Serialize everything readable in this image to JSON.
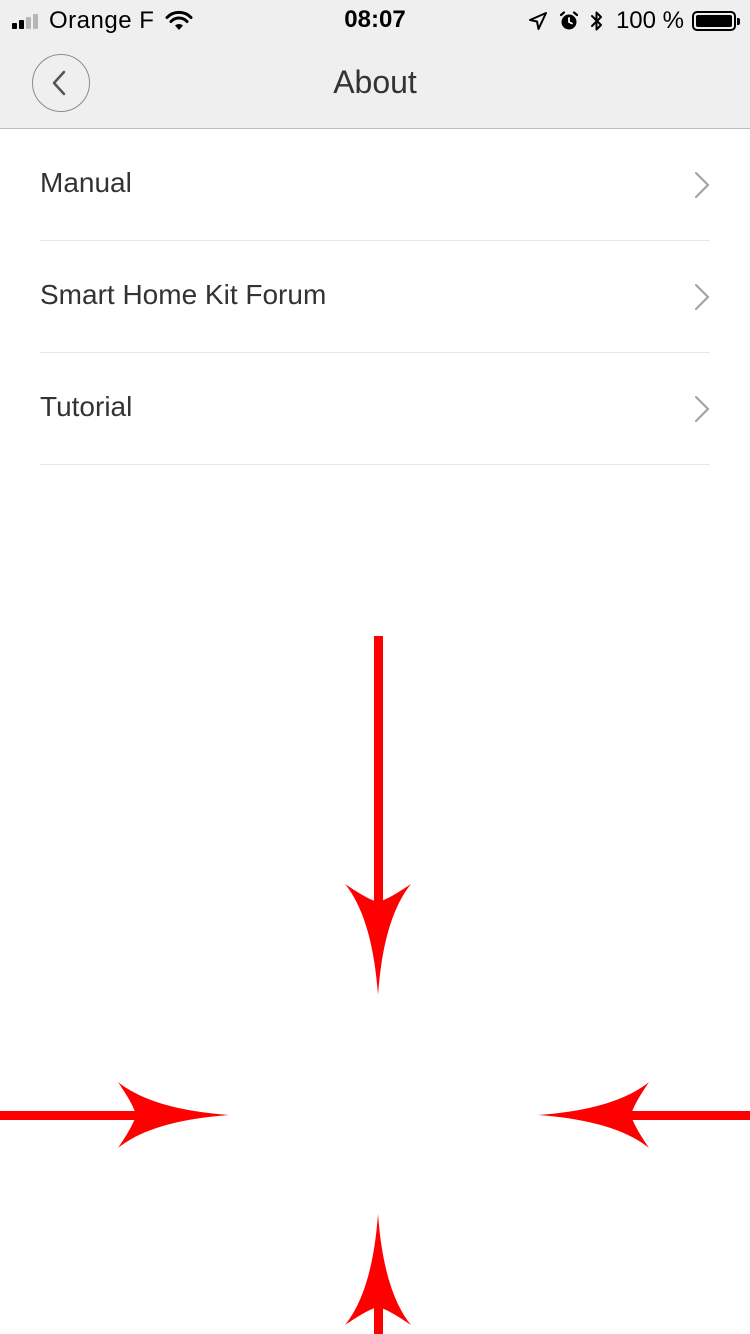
{
  "status_bar": {
    "carrier": "Orange F",
    "time": "08:07",
    "battery": "100 %",
    "battery_level": 1.0,
    "icons": [
      "signal-icon",
      "wifi-icon",
      "location-icon",
      "alarm-icon",
      "bluetooth-icon",
      "battery-icon"
    ]
  },
  "nav": {
    "title": "About",
    "back_icon": "chevron-left-icon"
  },
  "list": {
    "items": [
      {
        "label": "Manual",
        "icon": "chevron-right-icon"
      },
      {
        "label": "Smart Home Kit Forum",
        "icon": "chevron-right-icon"
      },
      {
        "label": "Tutorial",
        "icon": "chevron-right-icon"
      }
    ]
  },
  "overlay": {
    "arrow_color": "#ff0000",
    "arrows": [
      "arrow-down",
      "arrow-right",
      "arrow-left",
      "arrow-up"
    ]
  },
  "colors": {
    "header_background": "#efefef",
    "text": "#333333",
    "divider": "#e6e6e6",
    "chevron": "#a0a0a0"
  }
}
